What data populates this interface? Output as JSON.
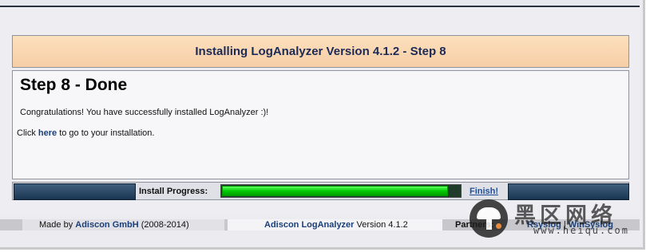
{
  "header": {
    "title": "Installing LogAnalyzer Version 4.1.2 - Step 8"
  },
  "content": {
    "heading": "Step 8 - Done",
    "congrats": "Congratulations! You have successfully installed LogAnalyzer :)!",
    "click_prefix": "Click ",
    "click_link": "here",
    "click_suffix": " to go to your installation."
  },
  "progress": {
    "label": "Install Progress:",
    "value_percent": 100,
    "finish_label": "Finish!"
  },
  "footer": {
    "made_prefix": "Made by ",
    "made_link": "Adiscon GmbH",
    "made_suffix": " (2008-2014)",
    "app_link": "Adiscon LogAnalyzer",
    "app_version": " Version 4.1.2",
    "partners_label": "Partners:",
    "partner_links": [
      "Rsyslog",
      "WinSyslog"
    ],
    "partner_sep": " | "
  },
  "watermark": {
    "brand_cn": "黑区网络",
    "url": "www.heiqu.com"
  },
  "colors": {
    "header_bg": "#f6cea6",
    "progress_fill": "#00c800",
    "link": "#1a3f7a",
    "finish": "#1f4f9a"
  }
}
